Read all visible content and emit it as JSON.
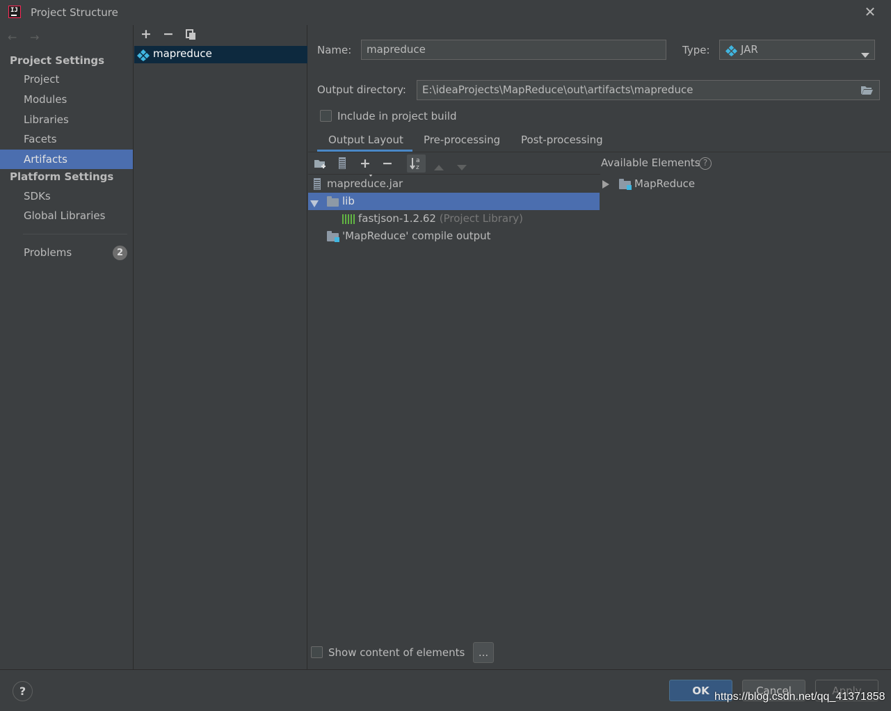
{
  "window": {
    "title": "Project Structure",
    "app_icon_text": "IJ"
  },
  "sidebar": {
    "project_settings_header": "Project Settings",
    "items": [
      {
        "label": "Project"
      },
      {
        "label": "Modules"
      },
      {
        "label": "Libraries"
      },
      {
        "label": "Facets"
      },
      {
        "label": "Artifacts",
        "selected": true
      }
    ],
    "platform_settings_header": "Platform Settings",
    "platform_items": [
      {
        "label": "SDKs"
      },
      {
        "label": "Global Libraries"
      }
    ],
    "problems": {
      "label": "Problems",
      "count": "2"
    }
  },
  "artifacts_list": {
    "items": [
      {
        "label": "mapreduce",
        "icon": "artifact-icon",
        "selected": true
      }
    ]
  },
  "form": {
    "name_label": "Name:",
    "name_value": "mapreduce",
    "type_label": "Type:",
    "type_value": "JAR",
    "output_dir_label": "Output directory:",
    "output_dir_value": "E:\\ideaProjects\\MapReduce\\out\\artifacts\\mapreduce",
    "include_build_label": "Include in project build",
    "include_build_checked": false
  },
  "tabs": [
    {
      "label": "Output Layout",
      "active": true
    },
    {
      "label": "Pre-processing"
    },
    {
      "label": "Post-processing"
    }
  ],
  "layout_tree": [
    {
      "label": "mapreduce.jar",
      "icon": "jar-icon"
    },
    {
      "label": "lib",
      "icon": "folder-icon",
      "expanded": true,
      "selected": true
    },
    {
      "label": "fastjson-1.2.62",
      "suffix": "(Project Library)",
      "icon": "library-icon"
    },
    {
      "label": "'MapReduce' compile output",
      "icon": "module-output-icon"
    }
  ],
  "available_elements": {
    "header": "Available Elements",
    "items": [
      {
        "label": "MapReduce",
        "icon": "module-folder-icon",
        "expanded": false
      }
    ]
  },
  "bottom": {
    "show_content_label": "Show content of elements",
    "show_content_checked": false,
    "ellipsis_label": "..."
  },
  "footer": {
    "help_label": "?",
    "ok_label": "OK",
    "cancel_label": "Cancel",
    "apply_label": "Apply",
    "watermark": "https://blog.csdn.net/qq_41371858"
  },
  "colors": {
    "background": "#3c3f41",
    "selection": "#4b6eaf",
    "accent_tab": "#4a88c7",
    "ok_button": "#365880"
  }
}
